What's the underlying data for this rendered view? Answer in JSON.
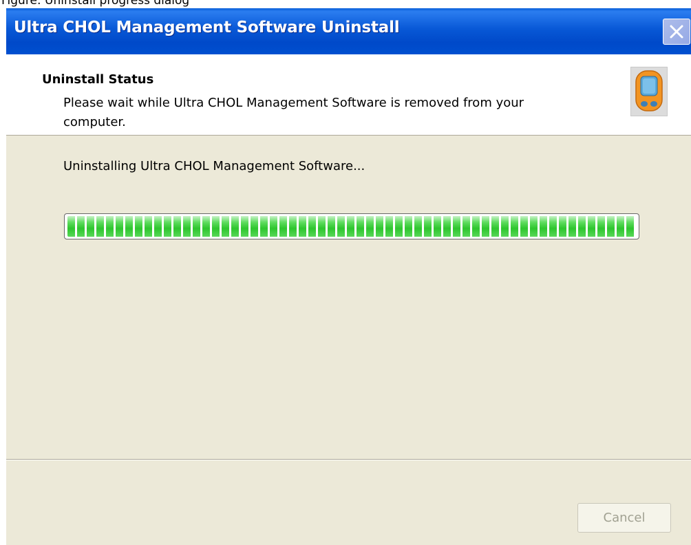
{
  "top_caption": "Figure: Uninstall progress dialog",
  "window": {
    "title": "Ultra CHOL Management Software Uninstall",
    "close_icon": "close-icon"
  },
  "header": {
    "title": "Uninstall Status",
    "description": "Please wait while Ultra CHOL Management Software is removed from your computer.",
    "icon": "glucose-meter-icon"
  },
  "body": {
    "status_text": "Uninstalling Ultra CHOL Management Software...",
    "progress_fraction": 1.0
  },
  "footer": {
    "cancel_label": "Cancel",
    "cancel_enabled": false
  },
  "colors": {
    "titlebar": "#0054e3",
    "dialog_background": "#ece9d8",
    "progress_green": "#32cc32",
    "disabled_text": "#a1a192"
  }
}
